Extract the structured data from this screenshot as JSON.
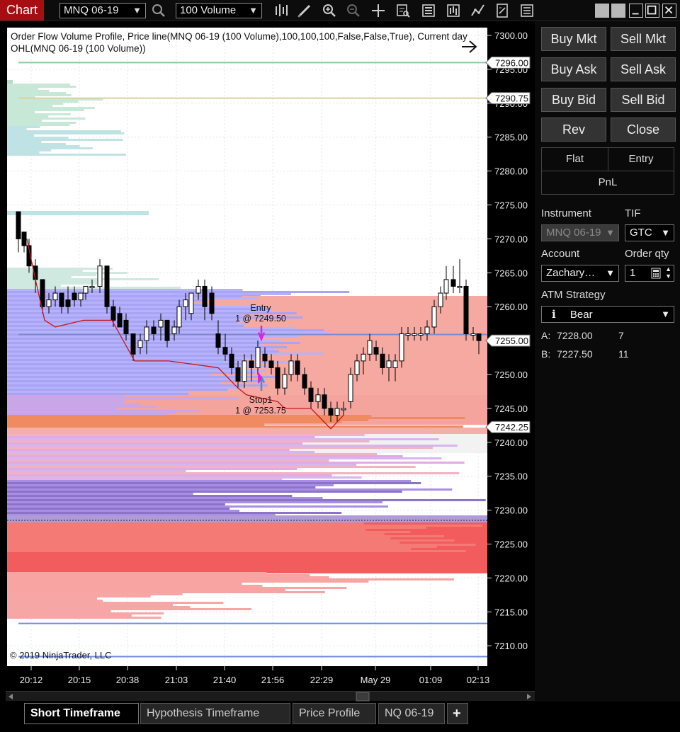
{
  "titlebar": {
    "app_title": "Chart",
    "instrument": "MNQ 06-19",
    "interval": "100 Volume"
  },
  "chart": {
    "legend_line1": "Order Flow Volume Profile, Price line(MNQ 06-19 (100 Volume),100,100,100,False,False,True), Current day",
    "legend_line2": "OHL(MNQ 06-19 (100 Volume))",
    "copyright": "© 2019 NinjaTrader, LLC",
    "entry_label": "Entry",
    "entry_detail": "1 @ 7249.50",
    "stop_label": "Stop1",
    "stop_detail": "1 @ 7253.75",
    "price_ticks": [
      "7300.00",
      "7295.00",
      "7290.00",
      "7285.00",
      "7280.00",
      "7275.00",
      "7270.00",
      "7265.00",
      "7260.00",
      "7255.00",
      "7250.00",
      "7245.00",
      "7240.00",
      "7235.00",
      "7230.00",
      "7225.00",
      "7220.00",
      "7215.00",
      "7210.00"
    ],
    "price_markers": [
      "7296.00",
      "7290.75",
      "7255.00",
      "7242.25"
    ],
    "time_ticks": [
      "20:12",
      "20:15",
      "20:38",
      "21:03",
      "21:40",
      "21:56",
      "22:29",
      "May 29",
      "01:09",
      "02:13"
    ]
  },
  "tabs": [
    "Short Timeframe",
    "Hypothesis Timeframe",
    "Price Profile",
    "NQ 06-19",
    "+"
  ],
  "panel": {
    "buy_mkt": "Buy Mkt",
    "sell_mkt": "Sell Mkt",
    "buy_ask": "Buy Ask",
    "sell_ask": "Sell Ask",
    "buy_bid": "Buy Bid",
    "sell_bid": "Sell Bid",
    "rev": "Rev",
    "close": "Close",
    "flat": "Flat",
    "entry": "Entry",
    "pnl": "PnL",
    "instrument_label": "Instrument",
    "tif_label": "TIF",
    "instrument_value": "MNQ 06-19",
    "tif_value": "GTC",
    "account_label": "Account",
    "qty_label": "Order qty",
    "account_value": "Zachary…",
    "qty_value": "1",
    "atm_label": "ATM Strategy",
    "atm_value": "Bear",
    "ask_label": "A:",
    "ask_price": "7228.00",
    "ask_size": "7",
    "bid_label": "B:",
    "bid_price": "7227.50",
    "bid_size": "11"
  }
}
